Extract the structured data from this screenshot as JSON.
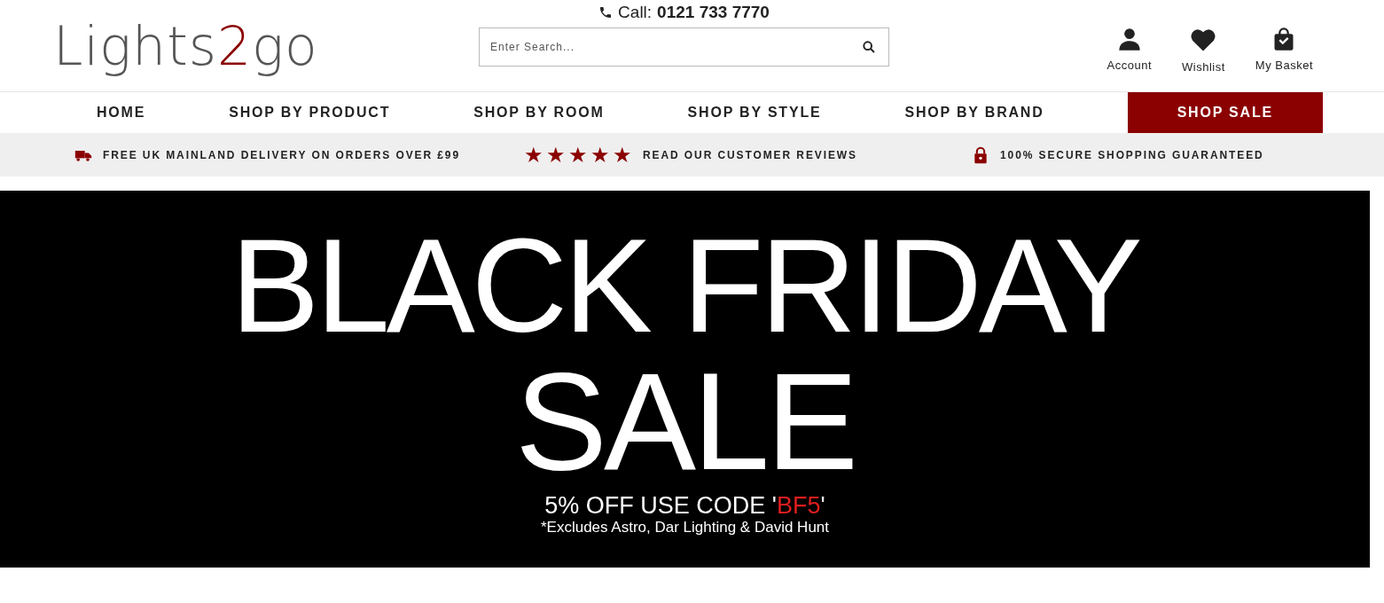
{
  "header": {
    "logo": {
      "before": "Lights",
      "accent": "2",
      "after": "go"
    },
    "phone_label": "Call:",
    "phone_number": "0121 733 7770",
    "search": {
      "placeholder": "Enter Search..."
    },
    "actions": [
      {
        "kind": "account",
        "label": "Account"
      },
      {
        "kind": "wishlist",
        "label": "Wishlist"
      },
      {
        "kind": "basket",
        "label": "My Basket"
      }
    ]
  },
  "nav": [
    {
      "label": "HOME",
      "highlighted": false
    },
    {
      "label": "SHOP BY PRODUCT",
      "highlighted": false
    },
    {
      "label": "SHOP BY ROOM",
      "highlighted": false
    },
    {
      "label": "SHOP BY STYLE",
      "highlighted": false
    },
    {
      "label": "SHOP BY BRAND",
      "highlighted": false
    },
    {
      "label": "SHOP SALE",
      "highlighted": true
    }
  ],
  "usp_bar": [
    {
      "kind": "delivery",
      "text": "FREE UK MAINLAND DELIVERY ON ORDERS OVER £99"
    },
    {
      "kind": "reviews",
      "stars": 5,
      "text": "READ OUR CUSTOMER REVIEWS"
    },
    {
      "kind": "secure",
      "text": "100% SECURE SHOPPING GUARANTEED"
    }
  ],
  "banner": {
    "title_lines": [
      "BLACK FRIDAY",
      "SALE"
    ],
    "offer": {
      "before": "5% OFF USE CODE '",
      "code": "BF5",
      "after": "'"
    },
    "note": "*Excludes Astro, Dar Lighting  & David Hunt"
  }
}
